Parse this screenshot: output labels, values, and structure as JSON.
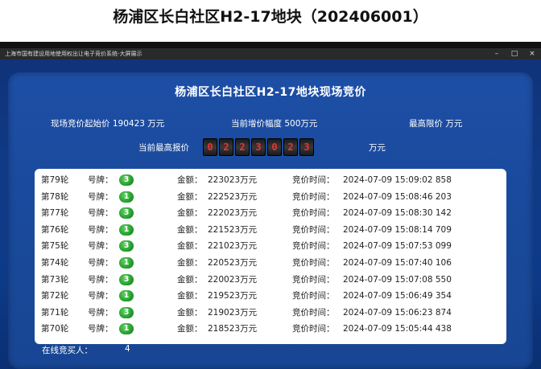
{
  "page_title": "杨浦区长白社区H2-17地块（202406001）",
  "window": {
    "title": "上海市国有建设用地使用权出让电子竞价系统-大屏展示",
    "buttons": [
      "–",
      "□",
      "×"
    ]
  },
  "auction": {
    "title": "杨浦区长白社区H2-17地块现场竞价",
    "start_price_label": "现场竞价起始价",
    "start_price_value": "190423",
    "start_price_unit": "万元",
    "increment_label": "当前增价幅度",
    "increment_value": "500万元",
    "max_price_label": "最高限价",
    "max_price_unit": "万元",
    "current_high_label": "当前最高报价",
    "current_high_digits": [
      "0",
      "2",
      "2",
      "3",
      "0",
      "2",
      "3"
    ],
    "current_high_unit": "万元"
  },
  "bids": [
    {
      "round": "第79轮",
      "plate_label": "号牌：",
      "plate": "3",
      "amount_label": "金额：",
      "amount": "223023万元",
      "time_label": "竞价时间：",
      "time": "2024-07-09 15:09:02 858"
    },
    {
      "round": "第78轮",
      "plate_label": "号牌：",
      "plate": "1",
      "amount_label": "金额：",
      "amount": "222523万元",
      "time_label": "竞价时间：",
      "time": "2024-07-09 15:08:46 203"
    },
    {
      "round": "第77轮",
      "plate_label": "号牌：",
      "plate": "3",
      "amount_label": "金额：",
      "amount": "222023万元",
      "time_label": "竞价时间：",
      "time": "2024-07-09 15:08:30 142"
    },
    {
      "round": "第76轮",
      "plate_label": "号牌：",
      "plate": "1",
      "amount_label": "金额：",
      "amount": "221523万元",
      "time_label": "竞价时间：",
      "time": "2024-07-09 15:08:14 709"
    },
    {
      "round": "第75轮",
      "plate_label": "号牌：",
      "plate": "3",
      "amount_label": "金额：",
      "amount": "221023万元",
      "time_label": "竞价时间：",
      "time": "2024-07-09 15:07:53 099"
    },
    {
      "round": "第74轮",
      "plate_label": "号牌：",
      "plate": "1",
      "amount_label": "金额：",
      "amount": "220523万元",
      "time_label": "竞价时间：",
      "time": "2024-07-09 15:07:40 106"
    },
    {
      "round": "第73轮",
      "plate_label": "号牌：",
      "plate": "3",
      "amount_label": "金额：",
      "amount": "220023万元",
      "time_label": "竞价时间：",
      "time": "2024-07-09 15:07:08 550"
    },
    {
      "round": "第72轮",
      "plate_label": "号牌：",
      "plate": "1",
      "amount_label": "金额：",
      "amount": "219523万元",
      "time_label": "竞价时间：",
      "time": "2024-07-09 15:06:49 354"
    },
    {
      "round": "第71轮",
      "plate_label": "号牌：",
      "plate": "3",
      "amount_label": "金额：",
      "amount": "219023万元",
      "time_label": "竞价时间：",
      "time": "2024-07-09 15:06:23 874"
    },
    {
      "round": "第70轮",
      "plate_label": "号牌：",
      "plate": "1",
      "amount_label": "金额：",
      "amount": "218523万元",
      "time_label": "竞价时间：",
      "time": "2024-07-09 15:05:44 438"
    }
  ],
  "online": {
    "label": "在线竞买人：",
    "count": "4"
  }
}
